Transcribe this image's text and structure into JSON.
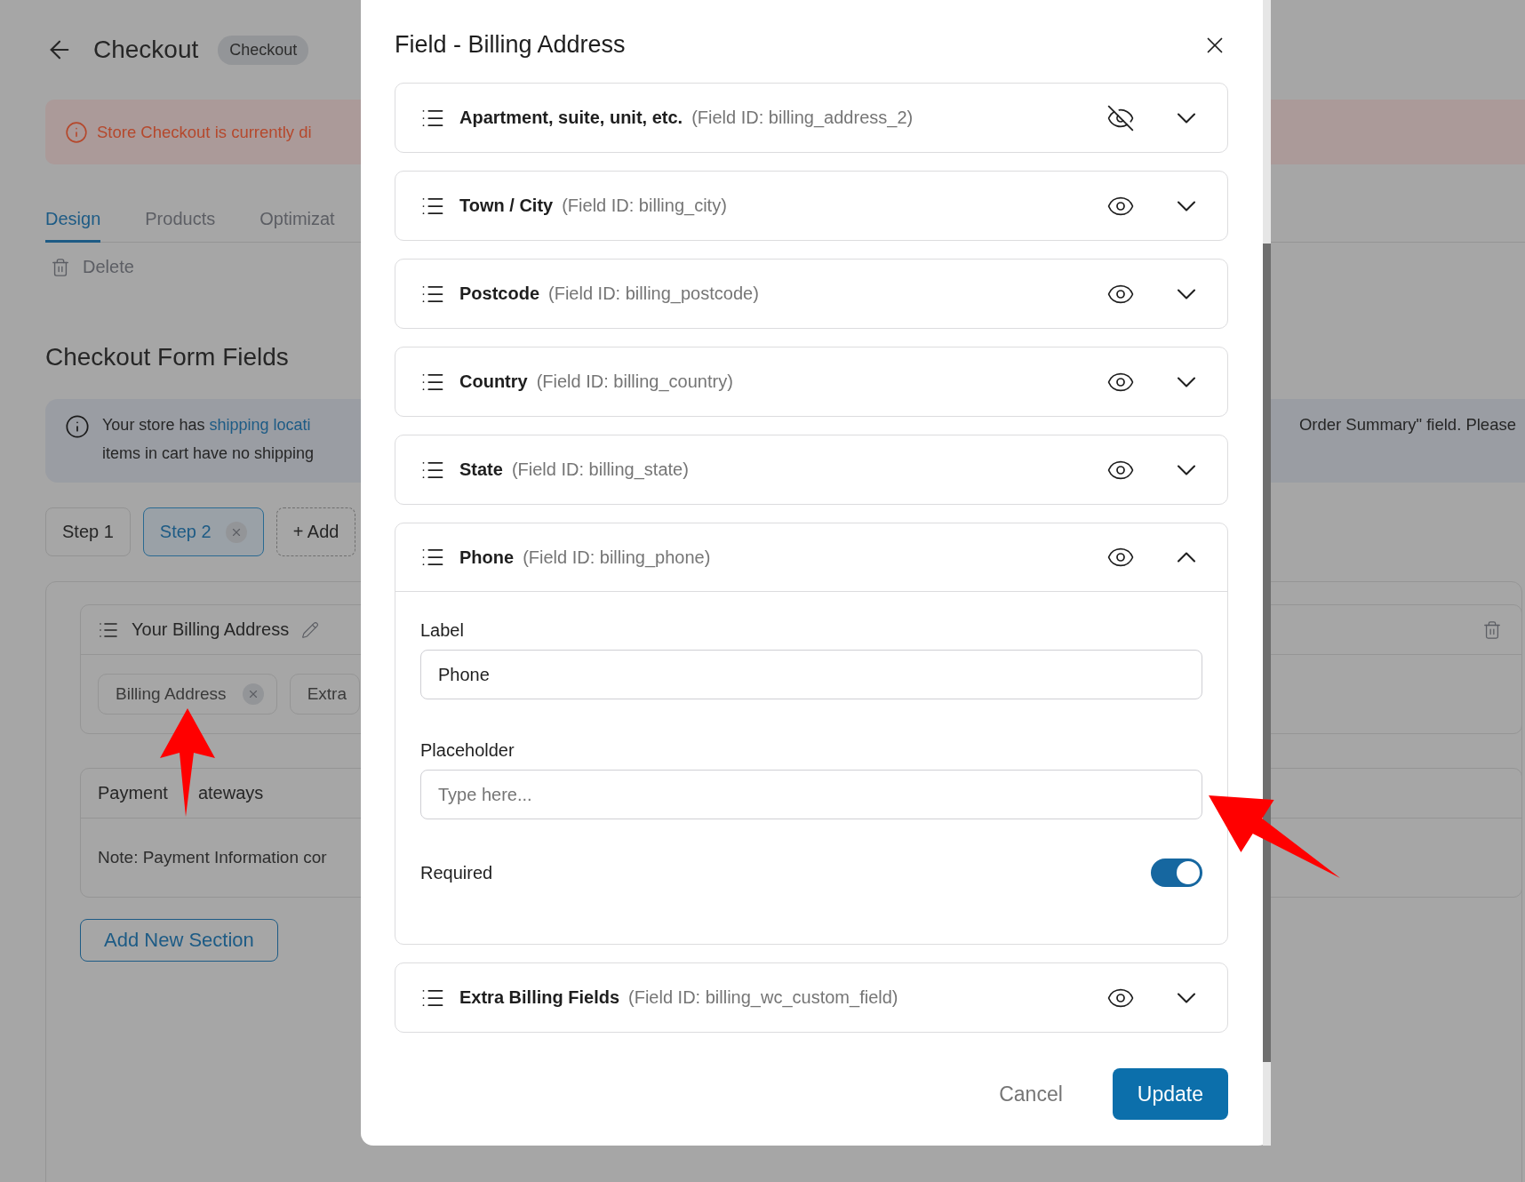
{
  "page": {
    "title": "Checkout",
    "badge": "Checkout"
  },
  "alert": "Store Checkout is currently di",
  "tabs": [
    {
      "label": "Design",
      "selected": true
    },
    {
      "label": "Products",
      "selected": false
    },
    {
      "label": "Optimizat",
      "selected": false
    }
  ],
  "delete_action": "Delete",
  "section_heading": "Checkout Form Fields",
  "notice": {
    "text": "Your store has ",
    "link": "shipping locati",
    "line_2": "items in cart have no shipping",
    "right_text": "Order Summary\" field. Please"
  },
  "steps": [
    {
      "label": "Step 1",
      "selected": false,
      "removable": false
    },
    {
      "label": "Step 2",
      "selected": true,
      "removable": true
    }
  ],
  "add_step": "+ Add",
  "sections": [
    {
      "title": "Your Billing Address",
      "chips": [
        {
          "label": "Billing Address",
          "removable": true
        },
        {
          "label": "Extra",
          "removable": false
        }
      ]
    },
    {
      "title_parts": [
        "Payment",
        "ateways"
      ],
      "note": "Note: Payment Information cor"
    }
  ],
  "add_section": "Add New Section",
  "modal": {
    "title": "Field - Billing Address",
    "fields": [
      {
        "label": "Apartment, suite, unit, etc.",
        "field_id": "(Field ID: billing_address_2)",
        "visible": false,
        "expanded": false
      },
      {
        "label": "Town / City",
        "field_id": "(Field ID: billing_city)",
        "visible": true,
        "expanded": false
      },
      {
        "label": "Postcode",
        "field_id": "(Field ID: billing_postcode)",
        "visible": true,
        "expanded": false
      },
      {
        "label": "Country",
        "field_id": "(Field ID: billing_country)",
        "visible": true,
        "expanded": false
      },
      {
        "label": "State",
        "field_id": "(Field ID: billing_state)",
        "visible": true,
        "expanded": false
      },
      {
        "label": "Phone",
        "field_id": "(Field ID: billing_phone)",
        "visible": true,
        "expanded": true,
        "editor": {
          "label_caption": "Label",
          "label_value": "Phone",
          "placeholder_caption": "Placeholder",
          "placeholder": "Type here...",
          "required_caption": "Required",
          "required": true
        }
      },
      {
        "label": "Extra Billing Fields",
        "field_id": "(Field ID: billing_wc_custom_field)",
        "visible": true,
        "expanded": false
      }
    ],
    "cancel": "Cancel",
    "update": "Update"
  }
}
